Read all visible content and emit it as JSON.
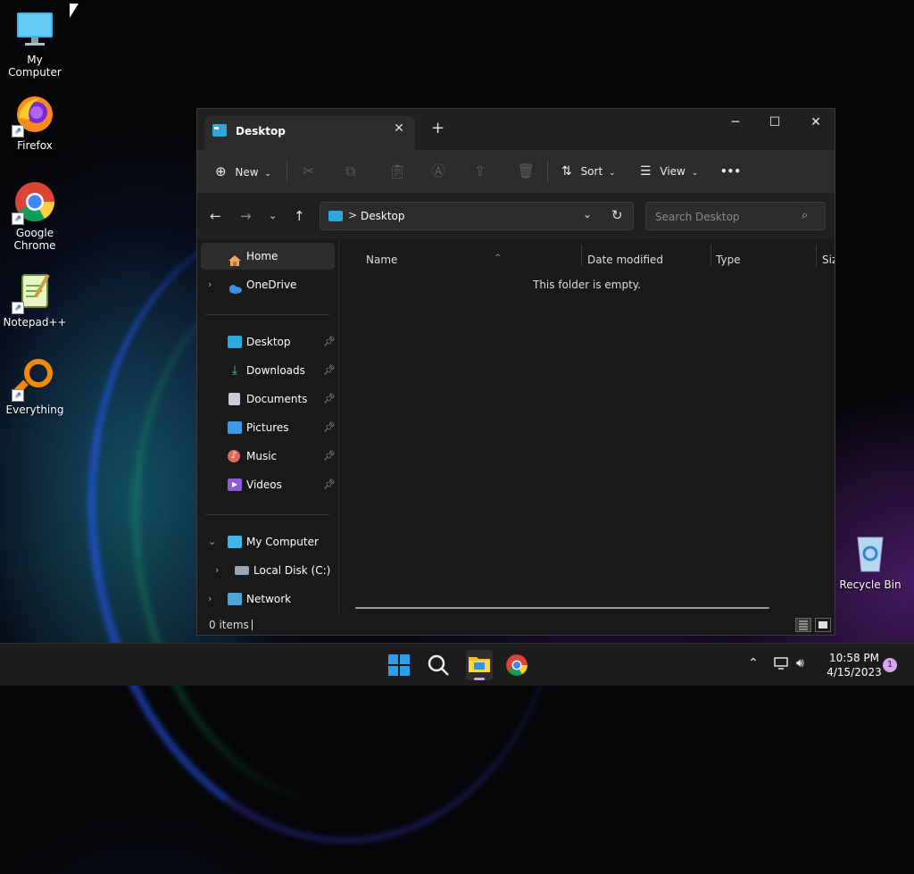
{
  "desktop": {
    "icons": [
      {
        "label": "My Computer",
        "icon": "monitor-icon"
      },
      {
        "label": "Firefox",
        "icon": "firefox-icon"
      },
      {
        "label": "Google Chrome",
        "icon": "chrome-icon"
      },
      {
        "label": "Notepad++",
        "icon": "notepadpp-icon"
      },
      {
        "label": "Everything",
        "icon": "everything-search-icon"
      },
      {
        "label": "Recycle Bin",
        "icon": "recycle-bin-icon"
      }
    ]
  },
  "window": {
    "tab_title": "Desktop",
    "new_tab": "+",
    "controls": {
      "minimize": "─",
      "maximize": "☐",
      "close": "✕"
    },
    "toolbar": {
      "new_label": "New",
      "sort_label": "Sort",
      "view_label": "View",
      "more_label": "•••"
    },
    "address": {
      "separator": ">",
      "path": "Desktop",
      "search_placeholder": "Search Desktop"
    },
    "sidebar": {
      "home": "Home",
      "onedrive": "OneDrive",
      "quick": [
        "Desktop",
        "Downloads",
        "Documents",
        "Pictures",
        "Music",
        "Videos"
      ],
      "my_computer": "My Computer",
      "local_disk": "Local Disk (C:)",
      "network": "Network"
    },
    "columns": [
      "Name",
      "Date modified",
      "Type",
      "Siz"
    ],
    "empty_message": "This folder is empty.",
    "status_items": "0 items"
  },
  "taskbar": {
    "time": "10:58 PM",
    "date": "4/15/2023",
    "notification_count": "1"
  },
  "colors": {
    "accent": "#29a9e0",
    "window_bg": "#191919",
    "toolbar_bg": "#2c2c2c",
    "taskbar_bg": "#1c1c1c"
  }
}
